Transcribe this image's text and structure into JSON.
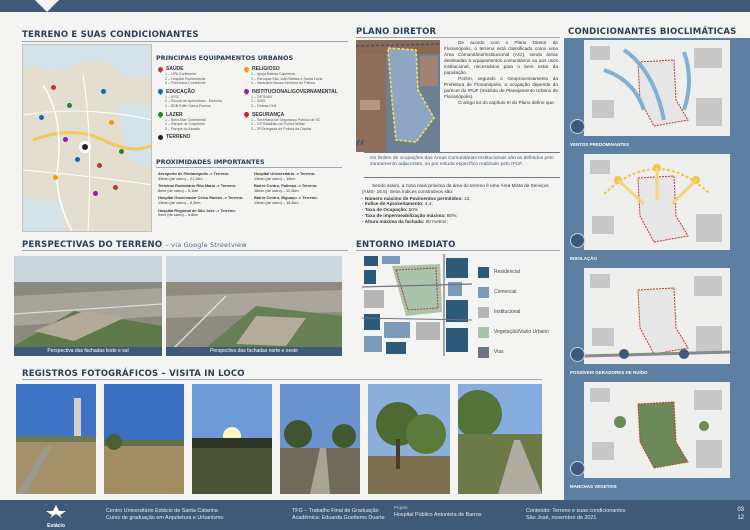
{
  "sections": {
    "terreno": "TERRENO E SUAS CONDICIONANTES",
    "plano": "PLANO DIRETOR",
    "bio": "CONDICIONANTES BIOCLIMÁTICAS",
    "perspectivas": "PERSPECTIVAS DO TERRENO",
    "perspectivas_sub": "– via Google Streetview",
    "entorno": "ENTORNO IMEDIATO",
    "registros": "REGISTROS FOTOGRÁFICOS – VISITA IN LOCO"
  },
  "legend": {
    "heading": "PRINCIPAIS EQUIPAMENTOS URBANOS",
    "saude": {
      "title": "SAÚDE",
      "items": [
        "1 – UPA Continente",
        "2 – Hospital Florianópolis",
        "3 – Policlínica Continente"
      ]
    },
    "educacao": {
      "title": "EDUCAÇÃO",
      "items": [
        "1 – IFSC",
        "2 – Escola de Aprendizes - Marinha",
        "3 – EEB Edith Gama Ramos"
      ]
    },
    "lazer": {
      "title": "LAZER",
      "items": [
        "1 – Beira Mar Continental",
        "2 – Parque de Coqueiros",
        "3 – Parque do Abraão"
      ]
    },
    "religioso": {
      "title": "RELIGIOSO",
      "items": [
        "1 – Igreja Batista Capoeiras",
        "2 – Paróquia São João Batista e Santa Luzia",
        "3 – Santuário Nossa Senhora de Fátima"
      ]
    },
    "institucional": {
      "title": "INSTITUCIONAL/GOVERNAMENTAL",
      "items": [
        "1 – DETRAN",
        "2 – INSS",
        "3 – Defesa Civil"
      ]
    },
    "seguranca": {
      "title": "SEGURANÇA",
      "items": [
        "1 – Secretaria de Segurança Pública de SC",
        "2 – 22º Batalhão da Polícia Militar",
        "3 – 3ª Delegacia de Polícia da Capital"
      ]
    },
    "terreno": "TERRENO",
    "prox_heading": "PROXIMIDADES IMPORTANTES",
    "prox": [
      {
        "name": "Aeroporto de Florianópolis -> Terreno:",
        "detail": "33min (de carro) – 21,2km"
      },
      {
        "name": "Hospital Universitário -> Terreno:",
        "detail": "13min (de carro) – 10km"
      },
      {
        "name": "Terminal Rodoviário Rita Maria -> Terreno:",
        "detail": "8min (de carro) – 5,1km"
      },
      {
        "name": "Bairro Centro, Palhoça -> Terreno:",
        "detail": "18min (de carro) – 12,5km"
      },
      {
        "name": "Hospital Governador Celso Ramos -> Terreno:",
        "detail": "13min (de carro) – 6,3km"
      },
      {
        "name": "Bairro Centro, Biguaçu -> Terreno:",
        "detail": "13min (de carro) – 16,4km"
      },
      {
        "name": "Hospital Regional de São José -> Terreno:",
        "detail": "9min (de carro) – 5,8km"
      }
    ]
  },
  "plano": {
    "p1": "De acordo com o Plano Diretor de Florianópolis, o terreno está classificado como uma Área Comunitária/Institucional (ACI), sendo áreas destinadas à equipamentos comunitários ou aos usos institucional, necessários para o bem estar da população.",
    "p2": "Porém, segundo o Geoprocessamento da Prefeitura de Florianópolis, a ocupação depende do parecer do IPUF (Instituto de Planejamento Urbano de Florianópolis).",
    "p3": "O artigo 54 do capítulo III do Plano define que:",
    "quote": "Os limites de ocupações das Áreas Comunitárias Institucionais são os definidos pelo zoneamento adjacentes, ou por estudo específico realizado pelo IPUF.",
    "p4": "Sendo assim, a zona mais próxima da área do terreno é uma Área Mista de Serviços (AMS- 16.5). Seus índices construtivos são:",
    "indices": [
      {
        "k": "· Número máximo de Pavimentos permitidos:",
        "v": " 12;"
      },
      {
        "k": "· Índice de Aproveitamento:",
        "v": " 4,4;"
      },
      {
        "k": "· Taxa de Ocupação:",
        "v": " 50%"
      },
      {
        "k": "· Taxa de impermeabilização máxima:",
        "v": " 80%;"
      },
      {
        "k": "· Altura máxima da fachada:",
        "v": " 60 metros;"
      }
    ]
  },
  "entorno_legend": [
    {
      "label": "Residencial",
      "color": "#2e5a7a"
    },
    {
      "label": "Comercial",
      "color": "#7a9cba"
    },
    {
      "label": "Institucional",
      "color": "#b5b5b5"
    },
    {
      "label": "Vegetação/Vazio Urbano",
      "color": "#a9c4ac"
    },
    {
      "label": "Vias",
      "color": "#6d7380"
    }
  ],
  "persp_captions": [
    "Perspectiva das fachadas leste e sul",
    "Perspectiva das fachadas norte e oeste"
  ],
  "bio_captions": [
    "VENTOS PREDOMINANTES",
    "INSOLAÇÃO",
    "POSSÍVEIS GERADORES DE RUÍDO",
    "MANCHAS VEGETAIS"
  ],
  "footer": {
    "logo": "Estácio",
    "inst1": "Centro Universitário Estácio de Santa Catarina",
    "inst2": "Curso de graduação em Arquitetura e Urbanismo",
    "tfg": "TFG – Trabalho Final de Graduação",
    "acad": "Acadêmica: Eduarda Goettems Duarte",
    "proj_label": "Projeto:",
    "proj": "Hospital Público Antonieta de Barros",
    "cont": "Conteúdo: Terreno e suas condicionantes",
    "date": "São José, novembro de 2021",
    "page": "03",
    "total": "12"
  },
  "colors": {
    "accent": "#3f5a78",
    "panel": "#5d7fa1"
  }
}
